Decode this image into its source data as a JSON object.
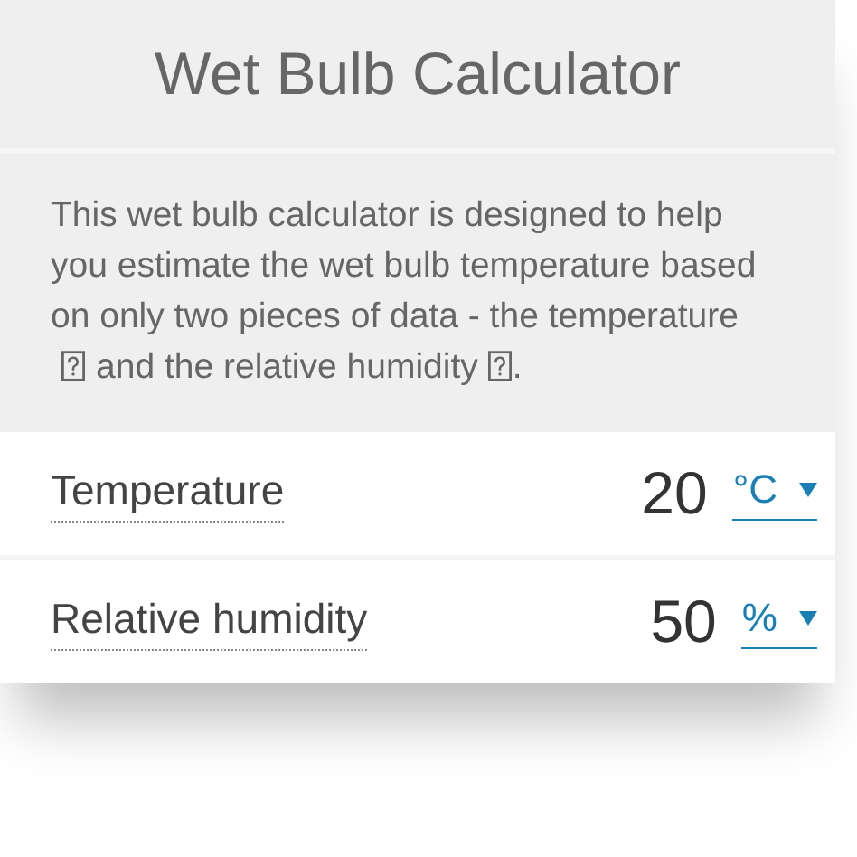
{
  "title": "Wet Bulb Calculator",
  "description": {
    "parts": [
      {
        "kind": "text",
        "text": "This wet bulb calculator is designed to help you estimate the wet bulb temperature based on only two pieces of data - the temperature"
      },
      {
        "kind": "help"
      },
      {
        "kind": "text",
        "text": "and the relative humidity"
      },
      {
        "kind": "help"
      },
      {
        "kind": "text",
        "text": "."
      }
    ]
  },
  "fields": [
    {
      "label": "Temperature",
      "value": "20",
      "unit": "°C"
    },
    {
      "label": "Relative humidity",
      "value": "50",
      "unit": "%"
    }
  ]
}
